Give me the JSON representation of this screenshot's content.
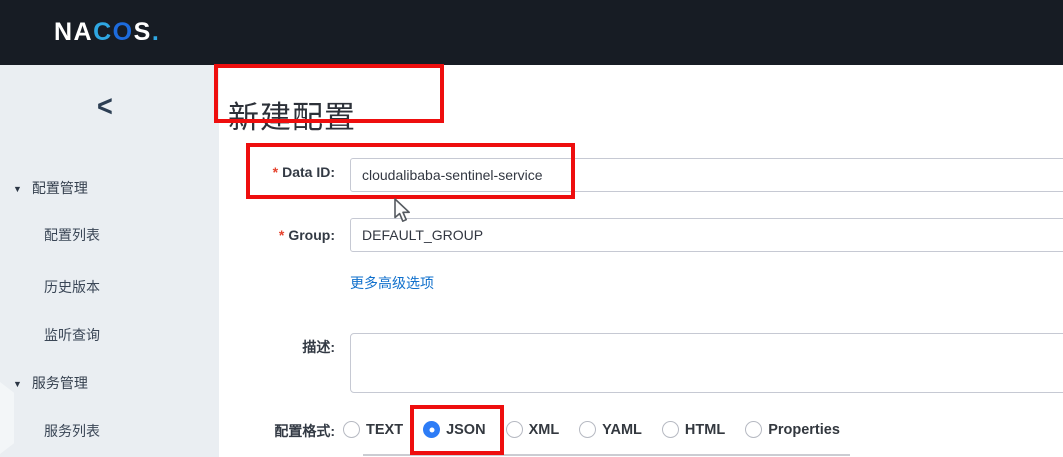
{
  "colors": {
    "header_bg": "#171c24",
    "sidebar_bg": "#eaeef2",
    "annotation": "#ee0e0e",
    "link": "#1070cc",
    "radio_selected": "#2d7cf6",
    "asterisk": "#e5432e",
    "logo_blue_light": "#2fa7e2",
    "logo_blue_dark": "#1d6bdc"
  },
  "icons": {
    "triangle_down": "▼",
    "collapse_left": "<"
  },
  "header": {
    "logo": {
      "part_na": "NA",
      "part_c": "C",
      "part_o": "O",
      "part_s": "S",
      "part_dot": "."
    }
  },
  "sidebar": {
    "sections": [
      {
        "label": "配置管理",
        "items": [
          "配置列表",
          "历史版本",
          "监听查询"
        ]
      },
      {
        "label": "服务管理",
        "items": [
          "服务列表"
        ]
      }
    ]
  },
  "main": {
    "title": "新建配置",
    "form": {
      "required_marker": "*",
      "data_id_label": "Data ID:",
      "data_id_value": "cloudalibaba-sentinel-service",
      "group_label": "Group:",
      "group_value": "DEFAULT_GROUP",
      "more_link": "更多高级选项",
      "desc_label": "描述:",
      "desc_value": "",
      "format_label": "配置格式:",
      "format_options": [
        "TEXT",
        "JSON",
        "XML",
        "YAML",
        "HTML",
        "Properties"
      ],
      "format_selected": "JSON"
    }
  }
}
